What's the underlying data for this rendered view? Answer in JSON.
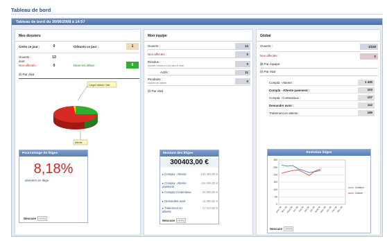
{
  "app": {
    "title": "Tableau de bord"
  },
  "dashboard": {
    "header": "Tableau de bord du 30/06/2008 à 14:57"
  },
  "mes_dossiers": {
    "title": "Mes dossiers",
    "crees_label": "Créés ce jour :",
    "crees_value": "0",
    "clotures_label": "Clôturés ce jour :",
    "clotures_value": "1",
    "ouverts_label": "Ouverts :",
    "ouverts_value": "13",
    "dont_label": "dont",
    "non_affectes_label": "Non affectés :",
    "non_affectes_value": "0",
    "dans_delais_label": "Dans les délais :",
    "dans_delais_value": "6",
    "par_etat": "⊟ Par état",
    "pie_label_top": "Longue attente / état",
    "pie_label_bottom": "Attente",
    "pie_colors": {
      "green": "#2fae2f",
      "red": "#d62a22",
      "yellow": "#e8e000"
    },
    "litiges_widget_title": "Pourcentage de litiges",
    "litiges_value": "8,18%",
    "litiges_sub": "dossiers en litige",
    "brand": "Neocase",
    "brand_tag": "HRM"
  },
  "mon_equipe": {
    "title": "Mon équipe",
    "rows": [
      {
        "label": "Ouverts :",
        "sub": "",
        "value": "13"
      },
      {
        "label": "Non affectés :",
        "sub": "",
        "value": "0"
      },
      {
        "label": "Résolus :",
        "sub": "dossiers résolus et clos dans le délai",
        "value": "0"
      },
      {
        "label": "Actifs :",
        "sub": "",
        "value": "11"
      },
      {
        "label": "Pendants :",
        "sub": "dossiers en attente",
        "value": "0"
      }
    ],
    "par_etat": "⊟ Par état",
    "montant_title": "Montant des litiges",
    "montant_value": "300403,00 €",
    "items": [
      {
        "label": "▸ Compta - Attente",
        "value": "133 485,00 €"
      },
      {
        "label": "▸ Compta - Attente paiement",
        "value": "118 286,00 €"
      },
      {
        "label": "▸ Compta Contentieux",
        "value": "20 090,00 €"
      },
      {
        "label": "▸ Demandes avoir",
        "value": "11 250,00 €"
      },
      {
        "label": "▸ Traitement en attente",
        "value": "17 413,00 €"
      }
    ],
    "brand": "Neocase",
    "brand_tag": "HRM"
  },
  "global": {
    "title": "Global",
    "ouverts_label": "Ouverts :",
    "ouverts_value": "1/318",
    "non_affectes_label": "Non affectés :",
    "non_affectes_value": "0",
    "par_equipe": "⊞ Par équipe",
    "par_etat": "⊟ Par état",
    "state_rows": [
      {
        "label": "Compta - Attente :",
        "value": "1 430",
        "bold": false
      },
      {
        "label": "Compta - Attente paiement :",
        "value": "103",
        "bold": true
      },
      {
        "label": "Compta - Contentieux :",
        "value": "107",
        "bold": false
      },
      {
        "label": "Demander avoir :",
        "value": "112",
        "bold": true
      },
      {
        "label": "Traitement en attente :",
        "value": "189",
        "bold": false
      }
    ],
    "chart_title": "Evolution litiges",
    "brand": "Neocase",
    "brand_tag": "HRM"
  },
  "chart_data": {
    "type": "line",
    "title": "Evolution litiges",
    "x": [
      "janv.-08",
      "févr.-08",
      "mars-08",
      "avr.-08",
      "mai-08",
      "juin-08",
      "juil.-08",
      "août-08",
      "sept.-08",
      "oct.-08",
      "nov.-08",
      "déc.-08"
    ],
    "series": [
      {
        "name": "Création",
        "color": "#4a78c0",
        "values": [
          265,
          258,
          262,
          240,
          228,
          215,
          222,
          228
        ]
      },
      {
        "name": "Clôture",
        "color": "#d8463c",
        "values": [
          210,
          220,
          228,
          232,
          215,
          195,
          225,
          238
        ]
      }
    ],
    "ylim": [
      0,
      300
    ],
    "yticks": [
      0,
      50,
      100,
      150,
      200,
      250,
      300
    ],
    "legend": "right",
    "grid": true
  }
}
